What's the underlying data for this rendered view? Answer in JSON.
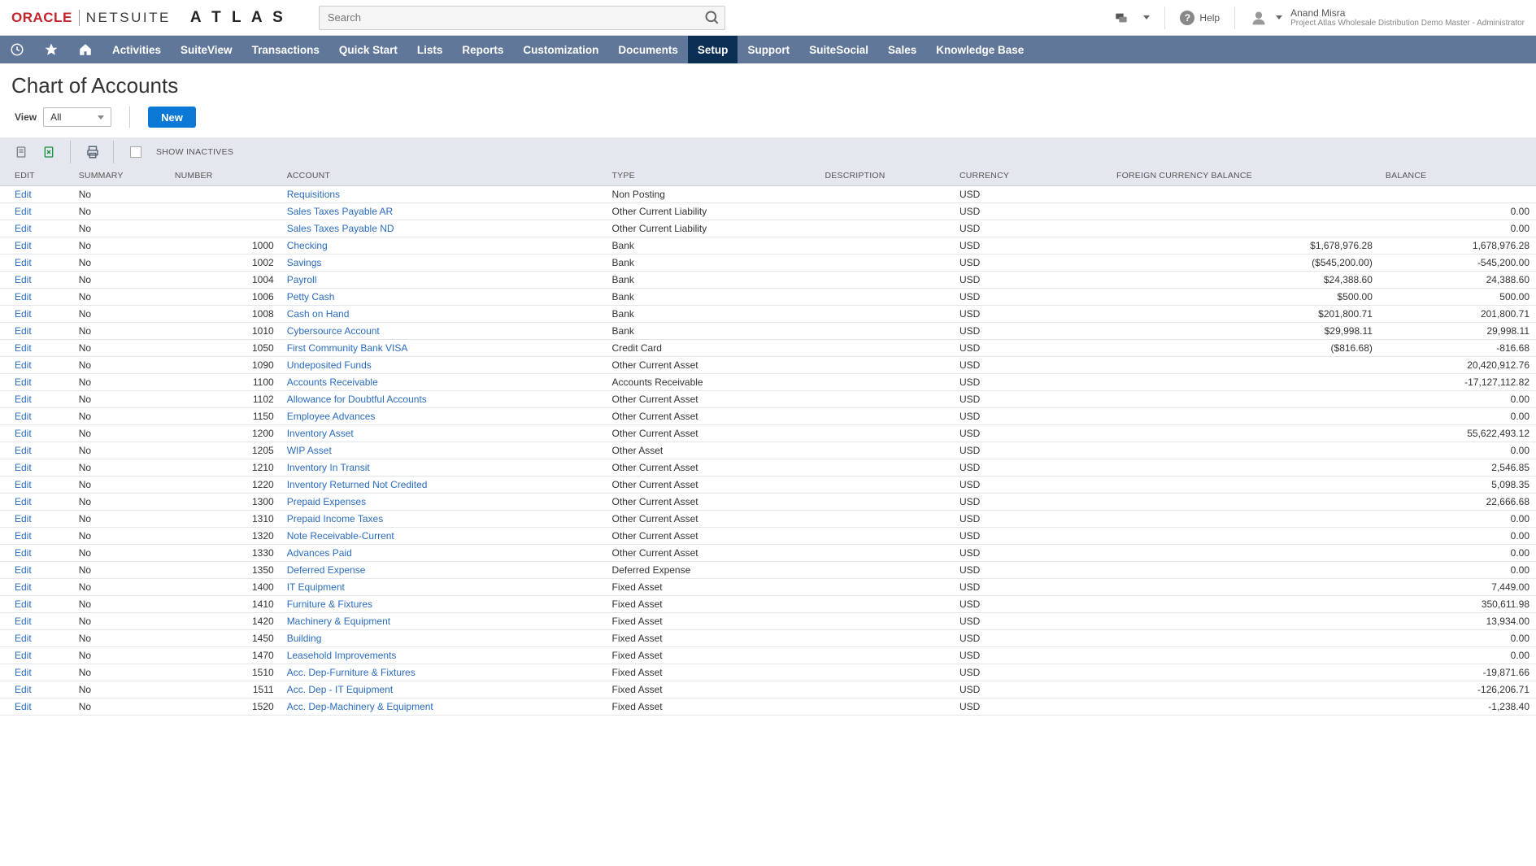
{
  "header": {
    "oracle": "ORACLE",
    "netsuite": "NETSUITE",
    "atlas": "A T L A S",
    "search_placeholder": "Search",
    "help": "Help",
    "user_name": "Anand Misra",
    "user_role": "Project Atlas Wholesale Distribution Demo Master - Administrator"
  },
  "nav": {
    "items": [
      "Activities",
      "SuiteView",
      "Transactions",
      "Quick Start",
      "Lists",
      "Reports",
      "Customization",
      "Documents",
      "Setup",
      "Support",
      "SuiteSocial",
      "Sales",
      "Knowledge Base"
    ],
    "active": "Setup"
  },
  "page": {
    "title": "Chart of Accounts",
    "view_label": "View",
    "view_value": "All",
    "new_btn": "New",
    "show_inactives": "SHOW INACTIVES"
  },
  "table": {
    "columns": {
      "edit": "EDIT",
      "summary": "SUMMARY",
      "number": "NUMBER",
      "account": "ACCOUNT",
      "type": "TYPE",
      "description": "DESCRIPTION",
      "currency": "CURRENCY",
      "fcb": "FOREIGN CURRENCY BALANCE",
      "balance": "BALANCE"
    },
    "edit_label": "Edit",
    "rows": [
      {
        "summary": "No",
        "number": "",
        "account": "Requisitions",
        "type": "Non Posting",
        "currency": "USD",
        "fcb": "",
        "balance": ""
      },
      {
        "summary": "No",
        "number": "",
        "account": "Sales Taxes Payable AR",
        "type": "Other Current Liability",
        "currency": "USD",
        "fcb": "",
        "balance": "0.00"
      },
      {
        "summary": "No",
        "number": "",
        "account": "Sales Taxes Payable ND",
        "type": "Other Current Liability",
        "currency": "USD",
        "fcb": "",
        "balance": "0.00"
      },
      {
        "summary": "No",
        "number": "1000",
        "account": "Checking",
        "type": "Bank",
        "currency": "USD",
        "fcb": "$1,678,976.28",
        "balance": "1,678,976.28"
      },
      {
        "summary": "No",
        "number": "1002",
        "account": "Savings",
        "type": "Bank",
        "currency": "USD",
        "fcb": "($545,200.00)",
        "balance": "-545,200.00"
      },
      {
        "summary": "No",
        "number": "1004",
        "account": "Payroll",
        "type": "Bank",
        "currency": "USD",
        "fcb": "$24,388.60",
        "balance": "24,388.60"
      },
      {
        "summary": "No",
        "number": "1006",
        "account": "Petty Cash",
        "type": "Bank",
        "currency": "USD",
        "fcb": "$500.00",
        "balance": "500.00"
      },
      {
        "summary": "No",
        "number": "1008",
        "account": "Cash on Hand",
        "type": "Bank",
        "currency": "USD",
        "fcb": "$201,800.71",
        "balance": "201,800.71"
      },
      {
        "summary": "No",
        "number": "1010",
        "account": "Cybersource Account",
        "type": "Bank",
        "currency": "USD",
        "fcb": "$29,998.11",
        "balance": "29,998.11"
      },
      {
        "summary": "No",
        "number": "1050",
        "account": "First Community Bank VISA",
        "type": "Credit Card",
        "currency": "USD",
        "fcb": "($816.68)",
        "balance": "-816.68"
      },
      {
        "summary": "No",
        "number": "1090",
        "account": "Undeposited Funds",
        "type": "Other Current Asset",
        "currency": "USD",
        "fcb": "",
        "balance": "20,420,912.76"
      },
      {
        "summary": "No",
        "number": "1100",
        "account": "Accounts Receivable",
        "type": "Accounts Receivable",
        "currency": "USD",
        "fcb": "",
        "balance": "-17,127,112.82"
      },
      {
        "summary": "No",
        "number": "1102",
        "account": "Allowance for Doubtful Accounts",
        "type": "Other Current Asset",
        "currency": "USD",
        "fcb": "",
        "balance": "0.00"
      },
      {
        "summary": "No",
        "number": "1150",
        "account": "Employee Advances",
        "type": "Other Current Asset",
        "currency": "USD",
        "fcb": "",
        "balance": "0.00"
      },
      {
        "summary": "No",
        "number": "1200",
        "account": "Inventory Asset",
        "type": "Other Current Asset",
        "currency": "USD",
        "fcb": "",
        "balance": "55,622,493.12"
      },
      {
        "summary": "No",
        "number": "1205",
        "account": "WIP Asset",
        "type": "Other Asset",
        "currency": "USD",
        "fcb": "",
        "balance": "0.00"
      },
      {
        "summary": "No",
        "number": "1210",
        "account": "Inventory In Transit",
        "type": "Other Current Asset",
        "currency": "USD",
        "fcb": "",
        "balance": "2,546.85"
      },
      {
        "summary": "No",
        "number": "1220",
        "account": "Inventory Returned Not Credited",
        "type": "Other Current Asset",
        "currency": "USD",
        "fcb": "",
        "balance": "5,098.35"
      },
      {
        "summary": "No",
        "number": "1300",
        "account": "Prepaid Expenses",
        "type": "Other Current Asset",
        "currency": "USD",
        "fcb": "",
        "balance": "22,666.68"
      },
      {
        "summary": "No",
        "number": "1310",
        "account": "Prepaid Income Taxes",
        "type": "Other Current Asset",
        "currency": "USD",
        "fcb": "",
        "balance": "0.00"
      },
      {
        "summary": "No",
        "number": "1320",
        "account": "Note Receivable-Current",
        "type": "Other Current Asset",
        "currency": "USD",
        "fcb": "",
        "balance": "0.00"
      },
      {
        "summary": "No",
        "number": "1330",
        "account": "Advances Paid",
        "type": "Other Current Asset",
        "currency": "USD",
        "fcb": "",
        "balance": "0.00"
      },
      {
        "summary": "No",
        "number": "1350",
        "account": "Deferred Expense",
        "type": "Deferred Expense",
        "currency": "USD",
        "fcb": "",
        "balance": "0.00"
      },
      {
        "summary": "No",
        "number": "1400",
        "account": "IT Equipment",
        "type": "Fixed Asset",
        "currency": "USD",
        "fcb": "",
        "balance": "7,449.00"
      },
      {
        "summary": "No",
        "number": "1410",
        "account": "Furniture & Fixtures",
        "type": "Fixed Asset",
        "currency": "USD",
        "fcb": "",
        "balance": "350,611.98"
      },
      {
        "summary": "No",
        "number": "1420",
        "account": "Machinery & Equipment",
        "type": "Fixed Asset",
        "currency": "USD",
        "fcb": "",
        "balance": "13,934.00"
      },
      {
        "summary": "No",
        "number": "1450",
        "account": "Building",
        "type": "Fixed Asset",
        "currency": "USD",
        "fcb": "",
        "balance": "0.00"
      },
      {
        "summary": "No",
        "number": "1470",
        "account": "Leasehold Improvements",
        "type": "Fixed Asset",
        "currency": "USD",
        "fcb": "",
        "balance": "0.00"
      },
      {
        "summary": "No",
        "number": "1510",
        "account": "Acc. Dep-Furniture & Fixtures",
        "type": "Fixed Asset",
        "currency": "USD",
        "fcb": "",
        "balance": "-19,871.66"
      },
      {
        "summary": "No",
        "number": "1511",
        "account": "Acc. Dep - IT Equipment",
        "type": "Fixed Asset",
        "currency": "USD",
        "fcb": "",
        "balance": "-126,206.71"
      },
      {
        "summary": "No",
        "number": "1520",
        "account": "Acc. Dep-Machinery & Equipment",
        "type": "Fixed Asset",
        "currency": "USD",
        "fcb": "",
        "balance": "-1,238.40"
      }
    ]
  }
}
